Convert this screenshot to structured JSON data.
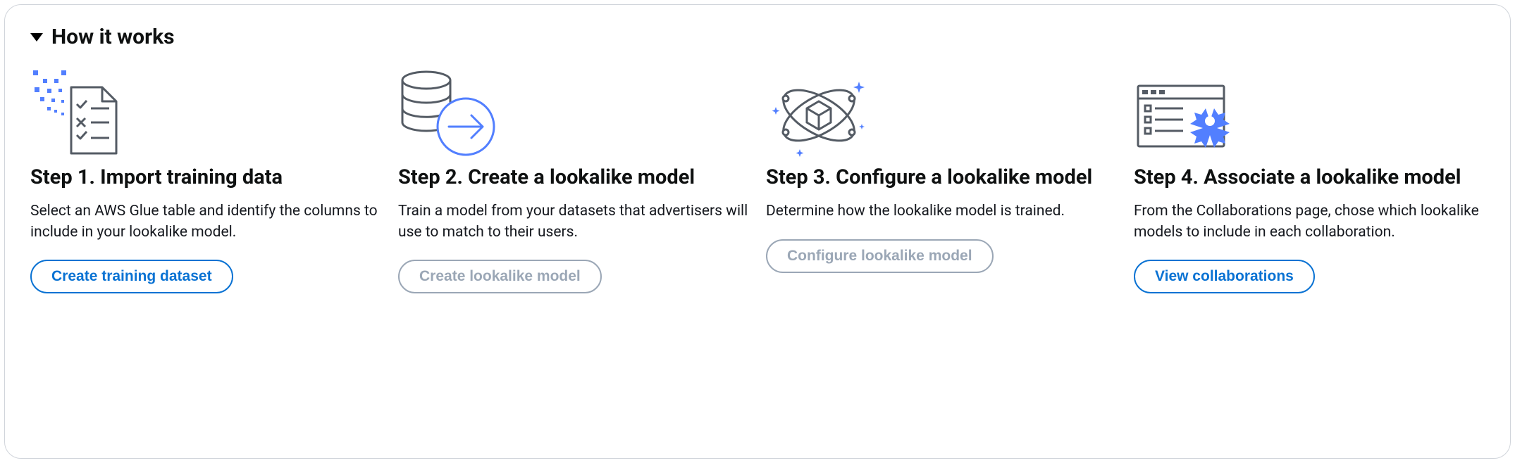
{
  "header": {
    "title": "How it works"
  },
  "steps": [
    {
      "title": "Step 1. Import training data",
      "desc": "Select an AWS Glue table and identify the columns to include in your lookalike model.",
      "button": "Create training dataset"
    },
    {
      "title": "Step 2. Create a lookalike model",
      "desc": "Train a model from your datasets that advertisers will use to match to their users.",
      "button": "Create lookalike model"
    },
    {
      "title": "Step 3. Configure a lookalike model",
      "desc": "Determine how the lookalike model is trained.",
      "button": "Configure lookalike model"
    },
    {
      "title": "Step 4. Associate a lookalike model",
      "desc": "From the Collaborations page, chose which lookalike models to include in each collaboration.",
      "button": "View collaborations"
    }
  ]
}
